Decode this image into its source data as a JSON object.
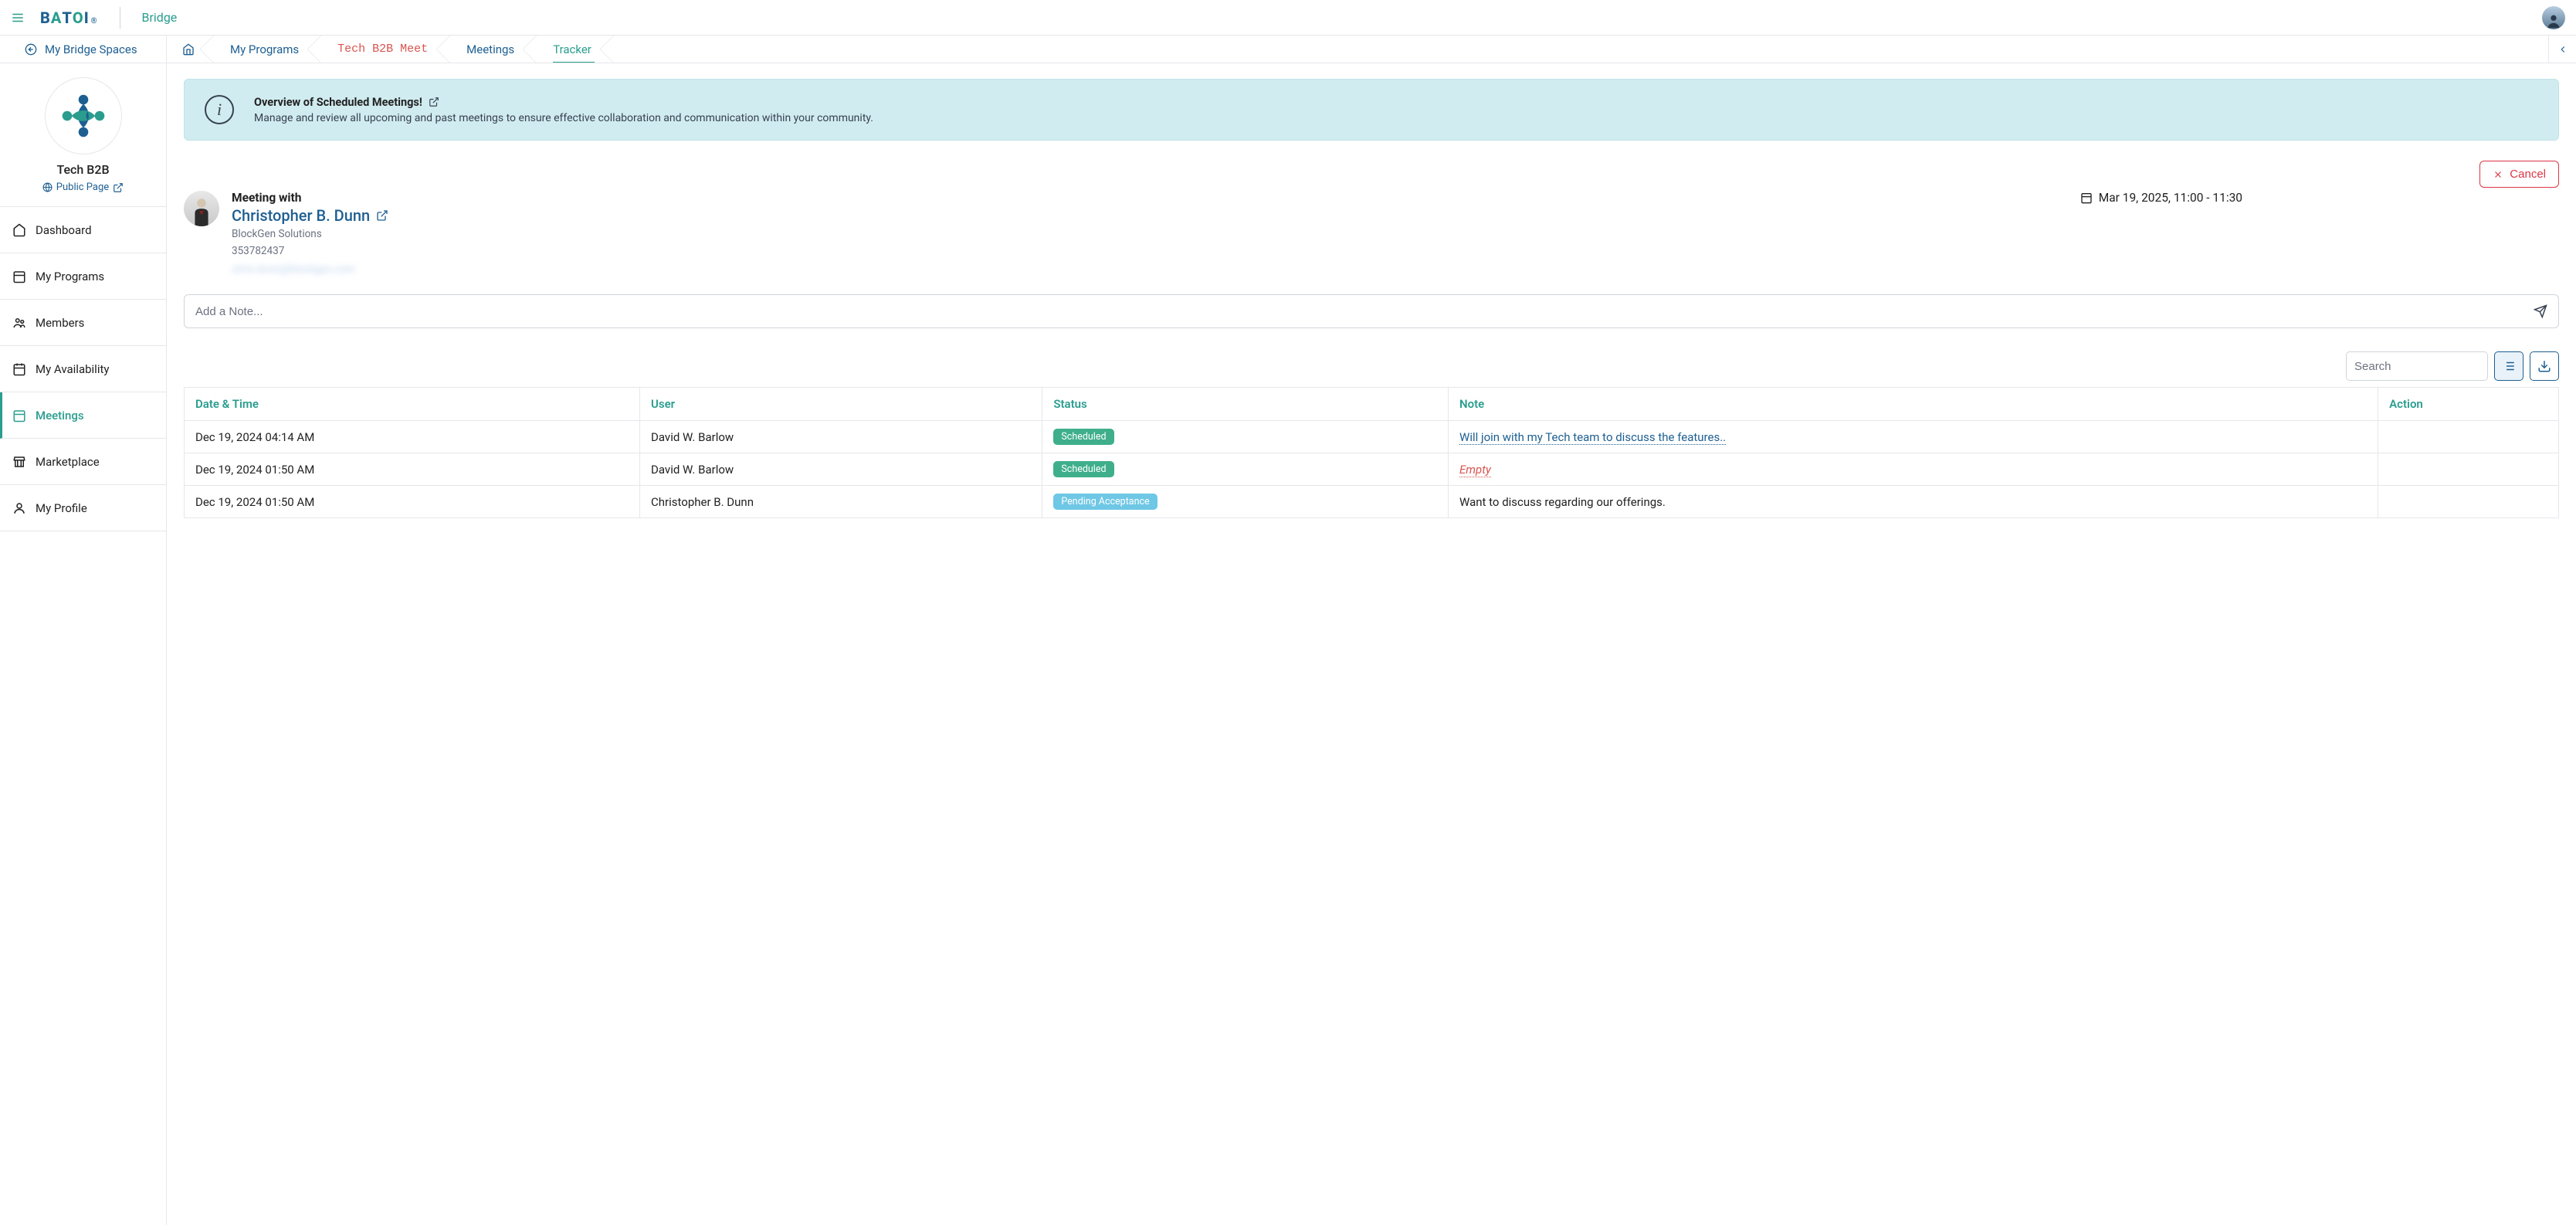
{
  "header": {
    "brand": "BATOI",
    "product": "Bridge"
  },
  "subbar": {
    "back_label": "My Bridge Spaces",
    "crumbs": [
      {
        "label": "",
        "kind": "home"
      },
      {
        "label": "My Programs",
        "kind": "blue"
      },
      {
        "label": "Tech B2B Meet",
        "kind": "red"
      },
      {
        "label": "Meetings",
        "kind": "blue"
      },
      {
        "label": "Tracker",
        "kind": "green",
        "active": true
      }
    ]
  },
  "sidebar": {
    "account_name": "Tech B2B",
    "public_page_label": "Public Page",
    "items": [
      {
        "label": "Dashboard",
        "icon": "home"
      },
      {
        "label": "My Programs",
        "icon": "calendar"
      },
      {
        "label": "Members",
        "icon": "users"
      },
      {
        "label": "My Availability",
        "icon": "calendar"
      },
      {
        "label": "Meetings",
        "icon": "calendar",
        "active": true
      },
      {
        "label": "Marketplace",
        "icon": "store"
      },
      {
        "label": "My Profile",
        "icon": "user"
      }
    ]
  },
  "banner": {
    "title": "Overview of Scheduled Meetings!",
    "desc": "Manage and review all upcoming and past meetings to ensure effective collaboration and communication within your community."
  },
  "cancel_label": "Cancel",
  "meeting": {
    "label": "Meeting with",
    "name": "Christopher B. Dunn",
    "company": "BlockGen Solutions",
    "id": "353782437",
    "email_blurred": "chris.dunn@blockgen.com",
    "date": "Mar 19, 2025, 11:00 - 11:30"
  },
  "note_input": {
    "placeholder": "Add a Note..."
  },
  "toolbar": {
    "search_placeholder": "Search"
  },
  "table": {
    "columns": [
      "Date & Time",
      "User",
      "Status",
      "Note",
      "Action"
    ],
    "rows": [
      {
        "datetime": "Dec 19, 2024 04:14 AM",
        "user": "David W. Barlow",
        "status": "Scheduled",
        "status_kind": "scheduled",
        "note": "Will join with my Tech team to discuss the features..",
        "note_kind": "link"
      },
      {
        "datetime": "Dec 19, 2024 01:50 AM",
        "user": "David W. Barlow",
        "status": "Scheduled",
        "status_kind": "scheduled",
        "note": "Empty",
        "note_kind": "empty"
      },
      {
        "datetime": "Dec 19, 2024 01:50 AM",
        "user": "Christopher B. Dunn",
        "status": "Pending Acceptance",
        "status_kind": "pending",
        "note": "Want to discuss regarding our offerings.",
        "note_kind": "text"
      }
    ]
  }
}
